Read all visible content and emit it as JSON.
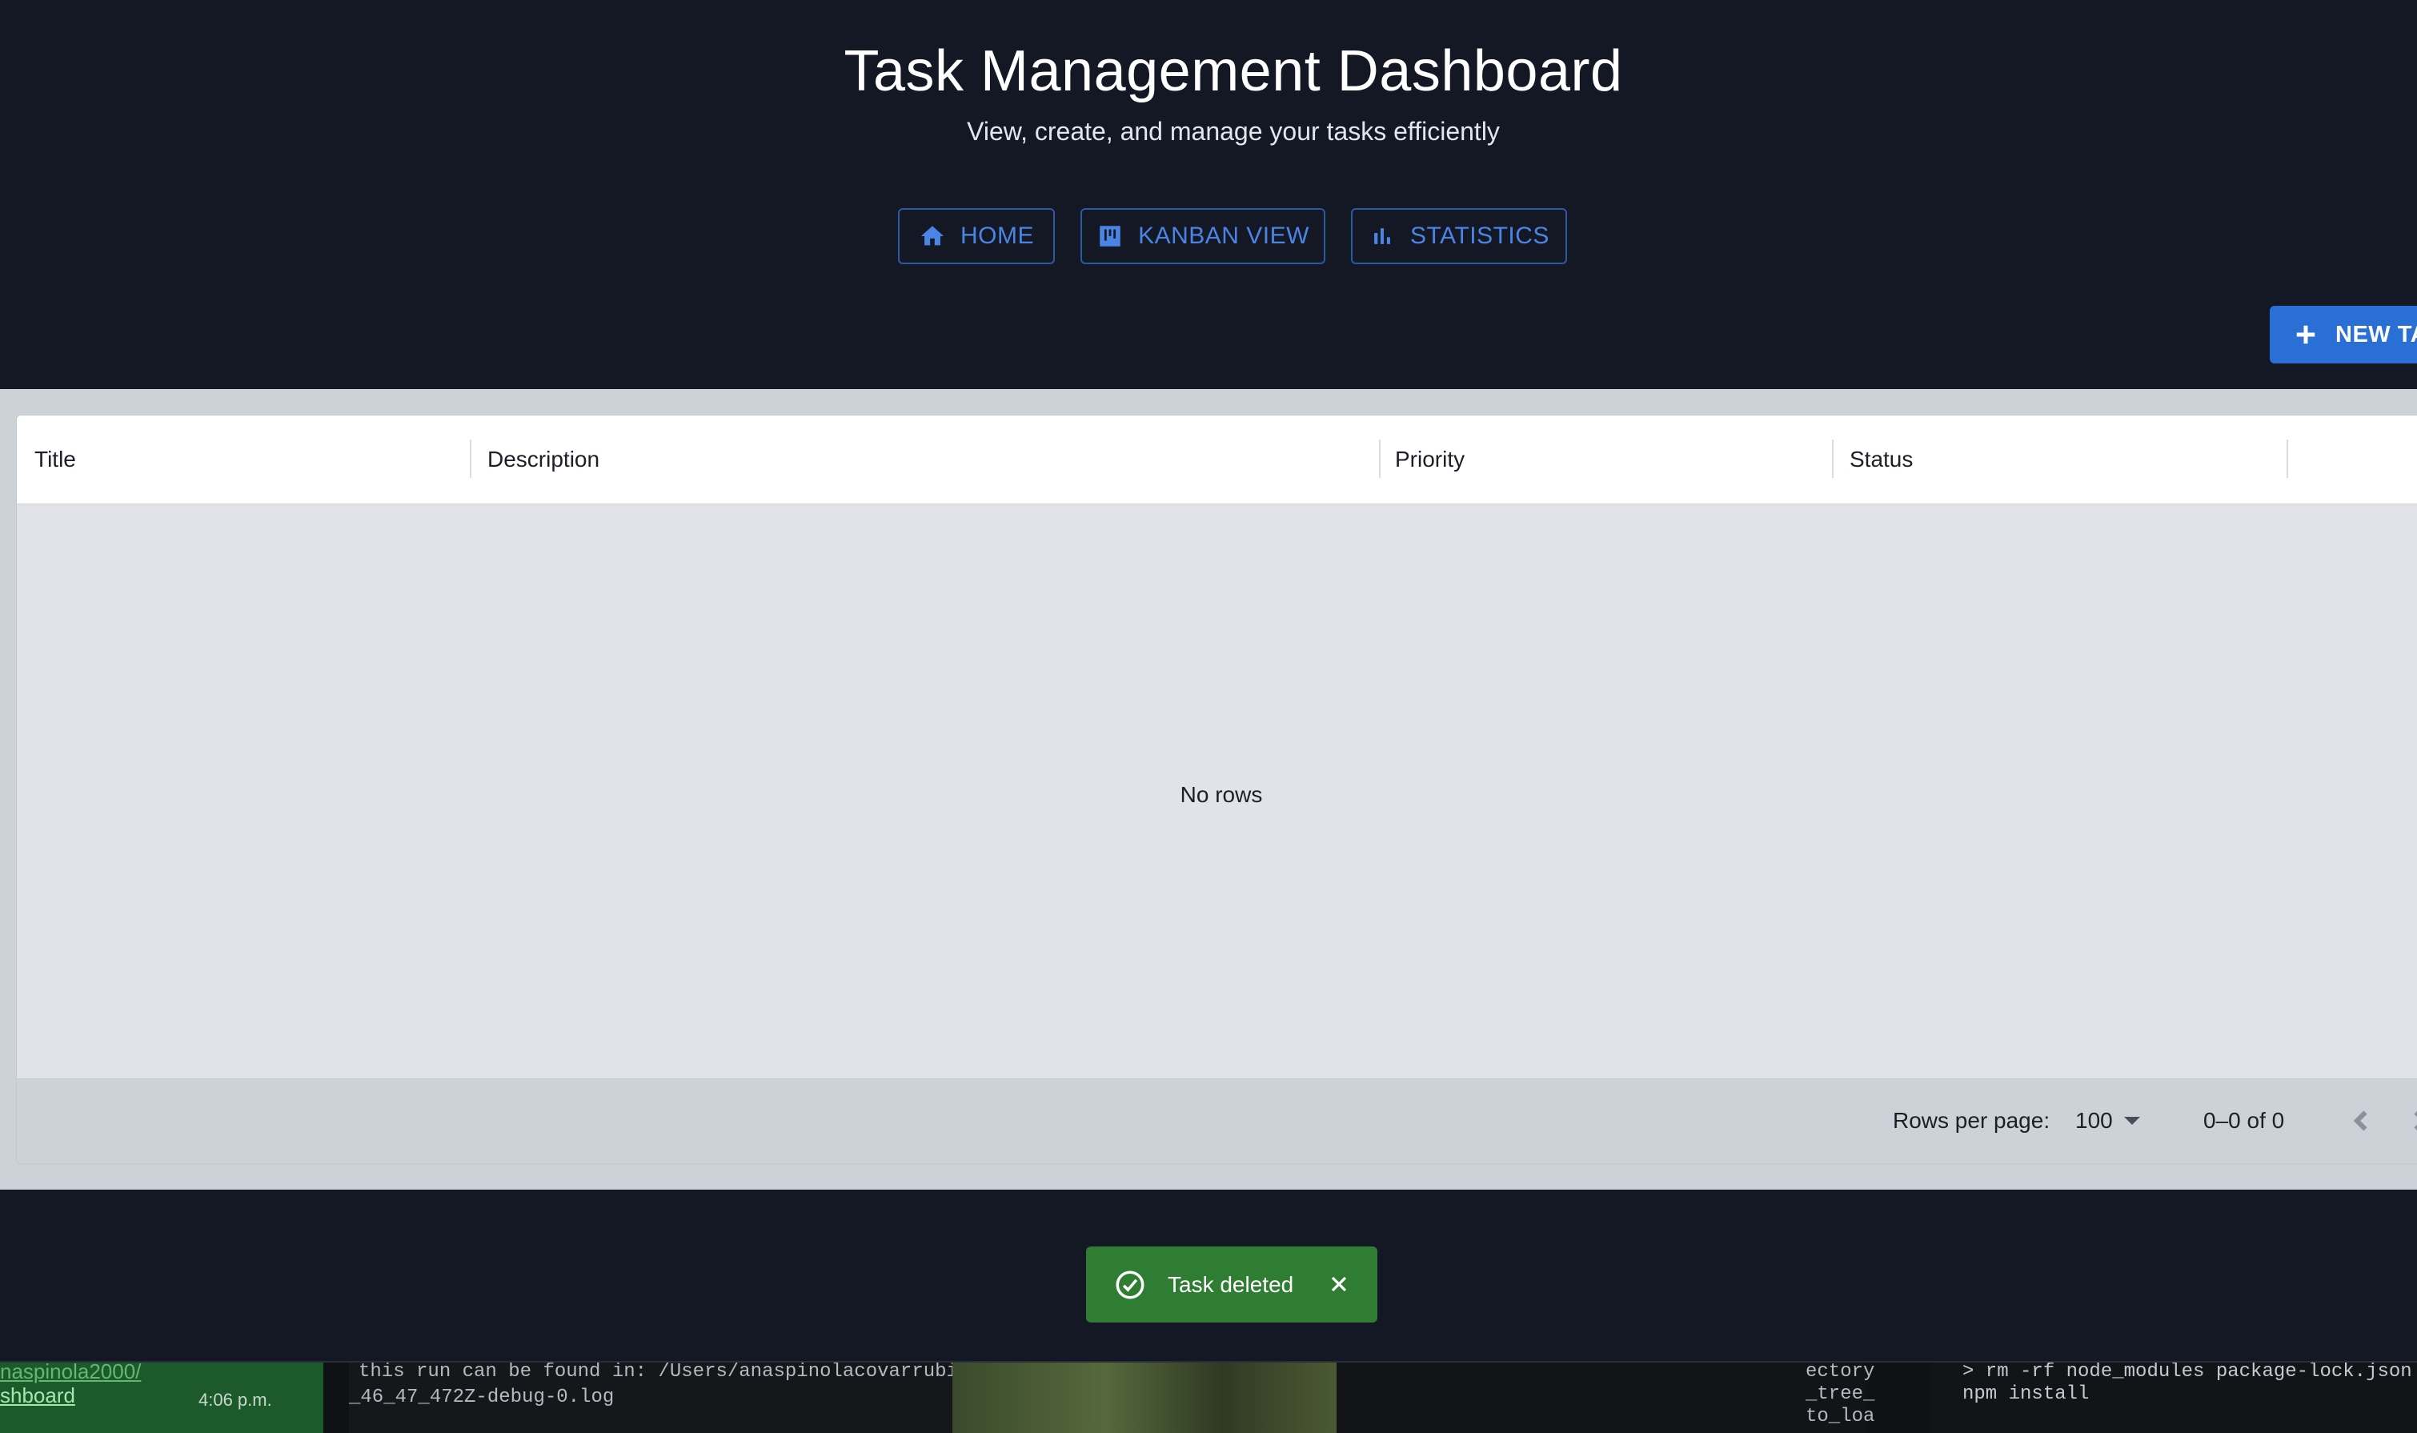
{
  "header": {
    "title": "Task Management Dashboard",
    "subtitle": "View, create, and manage your tasks efficiently"
  },
  "nav": {
    "home_label": "HOME",
    "kanban_label": "KANBAN VIEW",
    "statistics_label": "STATISTICS"
  },
  "actions": {
    "new_task_label": "NEW TA"
  },
  "grid": {
    "columns": [
      "Title",
      "Description",
      "Priority",
      "Status"
    ],
    "empty_text": "No rows",
    "footer": {
      "rows_per_page_label": "Rows per page:",
      "rows_per_page_value": "100",
      "range_text": "0–0 of 0"
    }
  },
  "toast": {
    "message": "Task deleted"
  },
  "taskbar": {
    "chat_line1": "naspinola2000/",
    "chat_line2": "shboard",
    "chat_time": "4:06 p.m.",
    "term1_line1": "this run can be found in: /Users/anaspinolacovarrubi",
    "term1_line2": "_46_47_472Z-debug-0.log",
    "term2_line1": "ectory",
    "term2_line2": "_tree_",
    "term2_line3": "to_loa",
    "term3_line1": "> rm -rf node_modules package-lock.json",
    "term3_line2": "npm install"
  },
  "colors": {
    "background": "#141824",
    "accent": "#2a6fd6",
    "toast": "#2e7d32"
  }
}
